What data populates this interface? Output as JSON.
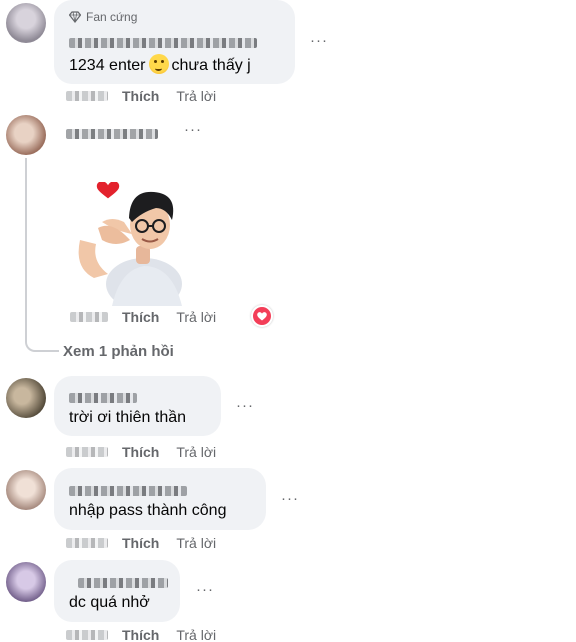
{
  "comments": [
    {
      "badge": "Fan cứng",
      "text_before": "1234 enter",
      "text_after": "chưa thấy j",
      "like": "Thích",
      "reply": "Trả lời"
    },
    {
      "like": "Thích",
      "reply": "Trả lời",
      "see_replies": "Xem 1 phản hồi"
    },
    {
      "text": "trời ơi thiên thần",
      "like": "Thích",
      "reply": "Trả lời"
    },
    {
      "text": "nhập pass thành công",
      "like": "Thích",
      "reply": "Trả lời"
    },
    {
      "text": "dc quá nhở",
      "like": "Thích",
      "reply": "Trả lời"
    }
  ],
  "more_label": "···",
  "icons": {
    "fan_badge": "diamond-icon",
    "emoji": "thinking-face-emoji-icon",
    "reaction": "heart-icon"
  },
  "colors": {
    "bubble": "#f0f2f5",
    "meta": "#65676b",
    "reaction": "#f33e58"
  }
}
